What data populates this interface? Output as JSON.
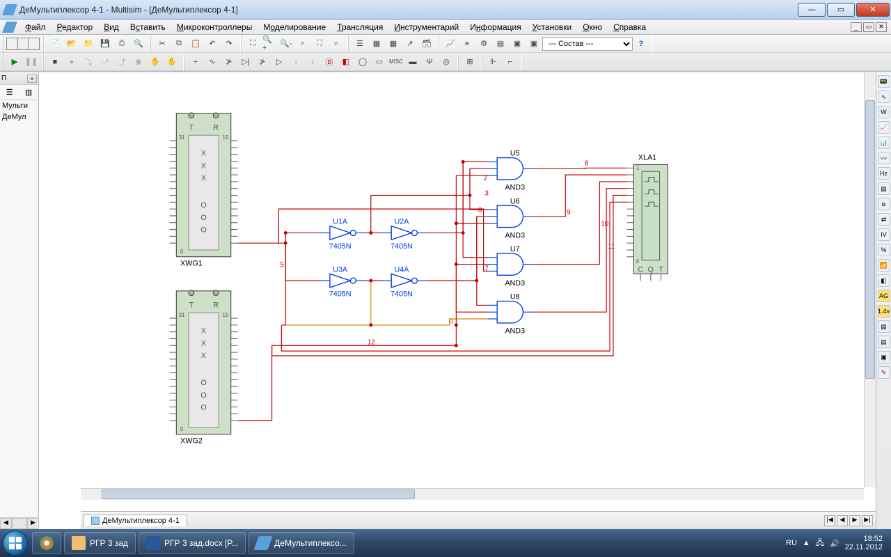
{
  "window": {
    "title": "ДеМультиплексор 4-1 - Multisim - [ДеМультиплексор 4-1]"
  },
  "menu": {
    "items": [
      "Файл",
      "Редактор",
      "Вид",
      "Вставить",
      "Микроконтроллеры",
      "Моделирование",
      "Трансляция",
      "Инструментарий",
      "Информация",
      "Установки",
      "Окно",
      "Справка"
    ]
  },
  "left_panel": {
    "header": "П",
    "items": [
      "Мульти",
      "ДеМул"
    ]
  },
  "toolbar": {
    "combo_default": "--- Состав ---"
  },
  "tab": {
    "label": "ДеМультиплексор 4-1"
  },
  "circuit": {
    "xwg1": {
      "name": "XWG1",
      "pin31": "31",
      "pin15": "15",
      "pin0": "0",
      "T": "T",
      "R": "R",
      "cols": "X\nX\nX\n\nO\nO\nO"
    },
    "xwg2": {
      "name": "XWG2",
      "pin31": "31",
      "pin15": "15",
      "pin0": "0",
      "T": "T",
      "R": "R"
    },
    "inverters": {
      "u1a": {
        "label": "U1A",
        "type": "7405N"
      },
      "u2a": {
        "label": "U2A",
        "type": "7405N"
      },
      "u3a": {
        "label": "U3A",
        "type": "7405N"
      },
      "u4a": {
        "label": "U4A",
        "type": "7405N"
      }
    },
    "and_gates": {
      "u5": {
        "label": "U5",
        "type": "AND3"
      },
      "u6": {
        "label": "U6",
        "type": "AND3"
      },
      "u7": {
        "label": "U7",
        "type": "AND3"
      },
      "u8": {
        "label": "U8",
        "type": "AND3"
      }
    },
    "xla1": {
      "name": "XLA1",
      "c": "C",
      "q": "Q",
      "t": "T",
      "f": "F",
      "one": "1"
    },
    "nets": {
      "n2": "2",
      "n3": "3",
      "n4": "4",
      "n5": "5",
      "n6": "6",
      "n7": "7",
      "n8": "8",
      "n9": "9",
      "n10": "10",
      "n11": "11",
      "n12": "12"
    }
  },
  "taskbar": {
    "items": [
      "РГР 3 зад",
      "РГР 3 зад.docx [Р...",
      "ДеМультиплексо..."
    ],
    "lang": "RU",
    "time": "18:52",
    "date": "22.11.2012"
  }
}
